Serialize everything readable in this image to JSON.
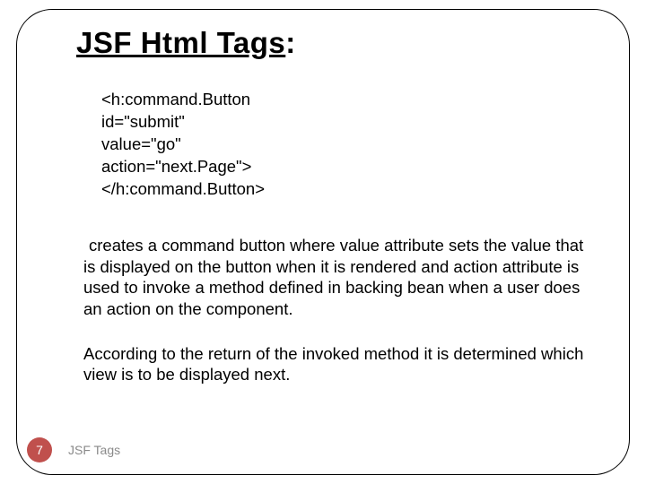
{
  "title_plain": "JSF Html Tags",
  "title_colon": ":",
  "code": {
    "l1": "<h:command.Button",
    "l2": "id=\"submit\"",
    "l3": "value=\"go\"",
    "l4": "action=\"next.Page\">",
    "l5": "</h:command.Button>"
  },
  "para1": "creates a command button where value attribute sets the value that is displayed on the button when it is rendered and action attribute is used to invoke a method defined in backing bean when a user does an action on the component.",
  "para2": "According to the return of the invoked method it is determined which view is to be displayed next.",
  "footer": {
    "page": "7",
    "label": "JSF Tags"
  }
}
